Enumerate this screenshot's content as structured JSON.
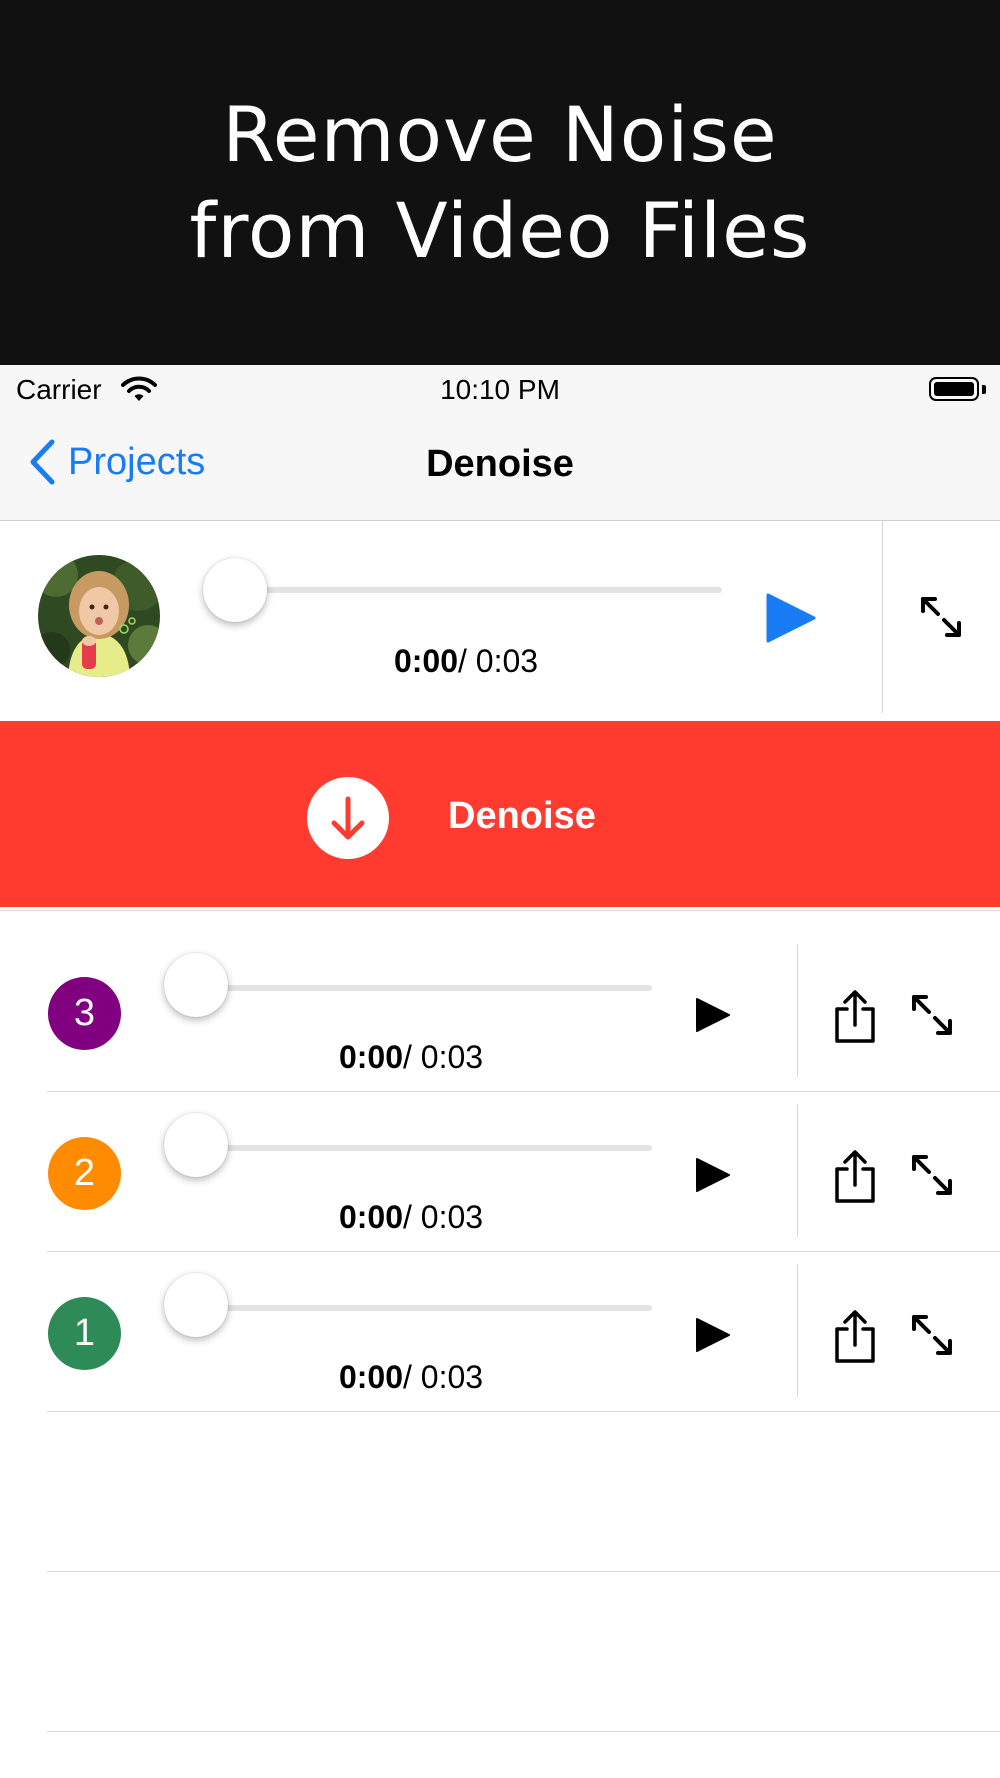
{
  "banner": {
    "line1": "Remove Noise",
    "line2": "from Video Files"
  },
  "status_bar": {
    "carrier": "Carrier",
    "time": "10:10 PM"
  },
  "nav": {
    "back_label": "Projects",
    "title": "Denoise"
  },
  "source": {
    "current_time": "0:00",
    "duration": "/ 0:03",
    "progress": 0
  },
  "action": {
    "label": "Denoise"
  },
  "results": [
    {
      "number": "3",
      "color": "#800080",
      "current_time": "0:00",
      "duration": "/ 0:03",
      "progress": 0
    },
    {
      "number": "2",
      "color": "#ff8c00",
      "current_time": "0:00",
      "duration": "/ 0:03",
      "progress": 0
    },
    {
      "number": "1",
      "color": "#2e8b57",
      "current_time": "0:00",
      "duration": "/ 0:03",
      "progress": 0
    }
  ],
  "colors": {
    "accent": "#1a7cf5",
    "action_background": "#ff3b30"
  },
  "icons": [
    "wifi-icon",
    "battery-icon",
    "chevron-left-icon",
    "play-icon",
    "expand-icon",
    "arrow-down-icon",
    "share-icon"
  ]
}
